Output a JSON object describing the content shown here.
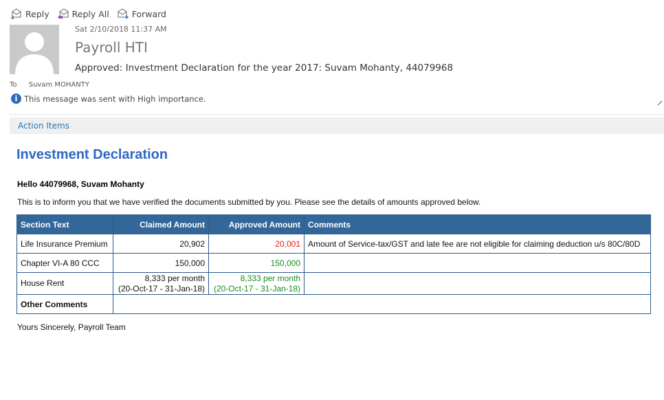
{
  "toolbar": {
    "reply": "Reply",
    "reply_all": "Reply All",
    "forward": "Forward"
  },
  "header": {
    "date": "Sat 2/10/2018 11:37 AM",
    "sender": "Payroll HTI",
    "subject": "Approved: Investment Declaration for the year 2017: Suvam Mohanty, 44079968",
    "to_label": "To",
    "to_name": "Suvam MOHANTY",
    "importance": "This message was sent with High importance."
  },
  "action_bar": {
    "label": "Action Items"
  },
  "body": {
    "heading": "Investment Declaration",
    "greeting": "Hello 44079968, Suvam Mohanty",
    "intro": "This is to inform you that we have verified the documents submitted by you. Please see the details of amounts approved below.",
    "signoff": "Yours Sincerely, Payroll Team"
  },
  "table": {
    "headers": [
      "Section Text",
      "Claimed Amount",
      "Approved Amount",
      "Comments"
    ],
    "rows": [
      {
        "section": "Life Insurance Premium",
        "claimed": "20,902",
        "approved": "20,001",
        "comments": "Amount of Service-tax/GST and late fee are not eligible for claiming deduction u/s 80C/80D"
      },
      {
        "section": "Chapter VI-A 80 CCC",
        "claimed": "150,000",
        "approved": "150,000",
        "comments": ""
      },
      {
        "section": "House Rent",
        "claimed_line1": "8,333 per month",
        "claimed_line2": "(20-Oct-17 - 31-Jan-18)",
        "approved_line1": "8,333 per month",
        "approved_line2": "(20-Oct-17 - 31-Jan-18)",
        "comments": ""
      },
      {
        "section": "Other Comments",
        "value": ""
      }
    ]
  },
  "colors": {
    "header_bg": "#336699",
    "heading": "#2f67c6",
    "approved_reduced": "#e11111",
    "approved_full": "#1a8a1a",
    "link": "#2e75b6"
  }
}
